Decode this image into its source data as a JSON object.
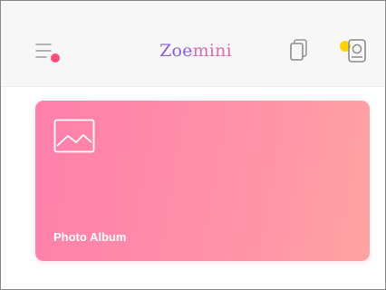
{
  "app": {
    "title_part1": "Zoe",
    "title_part2": "mini"
  },
  "icons": {
    "menu": "menu-icon",
    "copy": "copy-icon",
    "printer": "printer-icon",
    "album": "image-icon"
  },
  "album_card": {
    "label": "Photo Album"
  },
  "colors": {
    "accent_purple": "#8a5fd6",
    "accent_pink": "#d66fb2",
    "notification_dot": "#ff4d79",
    "printer_dot": "#ffd400",
    "card_gradient_start": "#ff7fab",
    "card_gradient_end": "#ffa3a2"
  }
}
